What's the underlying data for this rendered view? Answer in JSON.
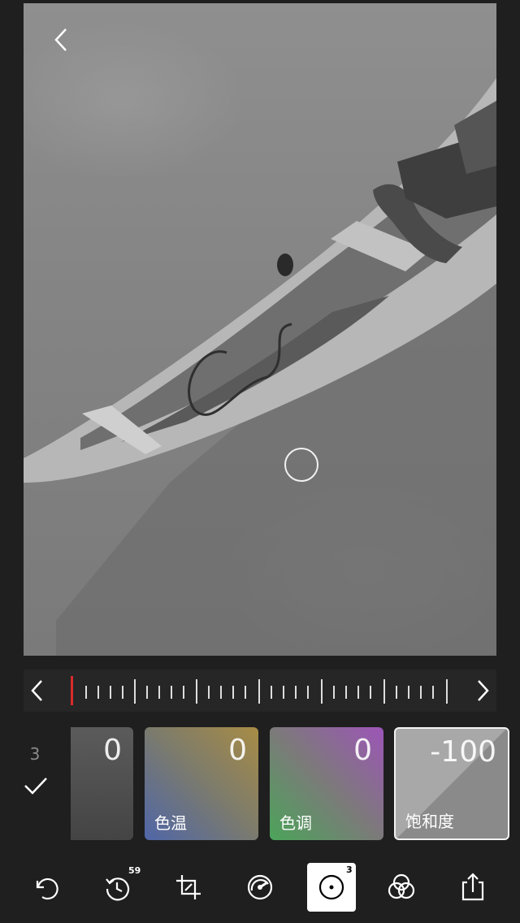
{
  "adjust_panel": {
    "count": "3",
    "cards": [
      {
        "label": "",
        "value": "0"
      },
      {
        "label": "色温",
        "value": "0"
      },
      {
        "label": "色调",
        "value": "0"
      },
      {
        "label": "饱和度",
        "value": "-100"
      }
    ]
  },
  "toolbar": {
    "history_badge": "59",
    "selective_badge": "3"
  },
  "icons": [
    "back-icon",
    "focus-ring",
    "ruler-left-icon",
    "ruler-right-icon",
    "check-icon",
    "undo-icon",
    "history-icon",
    "crop-icon",
    "dial-icon",
    "selective-icon",
    "overlay-icon",
    "share-icon"
  ],
  "colors": {
    "background": "#1f1f1f",
    "ruler_indicator": "#d92b2b",
    "active_tool": "#ffffff"
  }
}
